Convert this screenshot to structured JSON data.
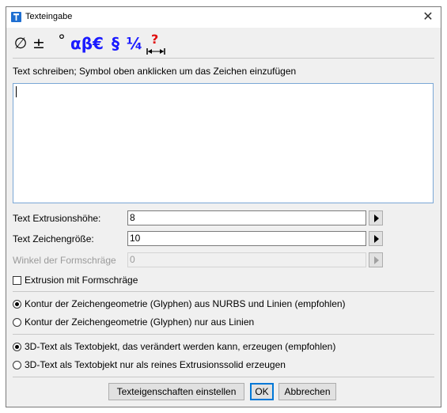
{
  "window": {
    "title": "Texteingabe"
  },
  "toolbar": {
    "diameter": "∅",
    "plusminus": "±",
    "degree": "°",
    "greek": "αβ",
    "euro": "€",
    "section": "§",
    "fraction": "¼",
    "help": "?"
  },
  "instruction": "Text schreiben; Symbol oben anklicken um das Zeichen einzufügen",
  "text_input": {
    "value": ""
  },
  "fields": {
    "extrusion_label": "Text Extrusionshöhe:",
    "extrusion_value": "8",
    "fontsize_label": "Text Zeichengröße:",
    "fontsize_value": "10",
    "draft_label": "Winkel der Formschräge",
    "draft_value": "0"
  },
  "checkbox_draft": {
    "label": "Extrusion mit Formschräge",
    "checked": false
  },
  "contour_options": [
    {
      "label": "Kontur der Zeichengeometrie (Glyphen) aus NURBS und Linien (empfohlen)",
      "selected": true
    },
    {
      "label": "Kontur der Zeichengeometrie (Glyphen) nur aus Linien",
      "selected": false
    }
  ],
  "object_options": [
    {
      "label": "3D-Text als Textobjekt, das verändert werden kann, erzeugen (empfohlen)",
      "selected": true
    },
    {
      "label": "3D-Text als Textobjekt nur als reines Extrusionssolid erzeugen",
      "selected": false
    }
  ],
  "buttons": {
    "properties": "Texteigenschaften einstellen",
    "ok": "OK",
    "cancel": "Abbrechen"
  }
}
